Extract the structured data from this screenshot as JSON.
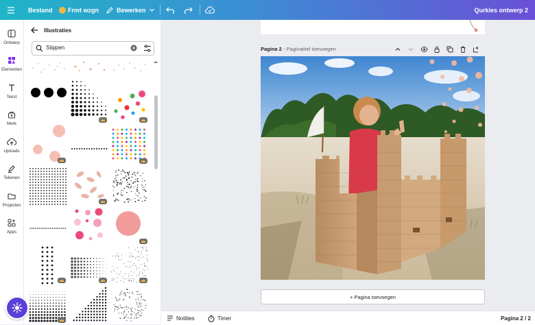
{
  "topbar": {
    "menu_icon": "hamburger-icon",
    "file_label": "Bestand",
    "resize_label": "Frmt wzgn",
    "edit_label": "Bewerken",
    "design_title": "Qurkies ontwerp 2"
  },
  "rail": {
    "items": [
      {
        "label": "Ontwerp",
        "icon": "layout-icon"
      },
      {
        "label": "Elementen",
        "icon": "elements-icon"
      },
      {
        "label": "Tekst",
        "icon": "text-icon"
      },
      {
        "label": "Merk",
        "icon": "brand-icon"
      },
      {
        "label": "Uploads",
        "icon": "cloud-upload-icon"
      },
      {
        "label": "Tekenen",
        "icon": "draw-icon"
      },
      {
        "label": "Projecten",
        "icon": "folder-icon"
      },
      {
        "label": "Apps",
        "icon": "apps-icon"
      }
    ],
    "active_index": 1
  },
  "panel": {
    "title": "Illustraties",
    "search_value": "Stippen",
    "tiles": [
      {
        "kind": "pastel-dots",
        "pro": false
      },
      {
        "kind": "peach-confetti",
        "pro": false
      },
      {
        "kind": "grey-scatter",
        "pro": false
      },
      {
        "kind": "three-black-circles",
        "pro": false
      },
      {
        "kind": "halftone-corner",
        "pro": true
      },
      {
        "kind": "colorful-confetti",
        "pro": true
      },
      {
        "kind": "pink-circles",
        "pro": true
      },
      {
        "kind": "dotted-line",
        "pro": false
      },
      {
        "kind": "rainbow-dot-grid",
        "pro": true
      },
      {
        "kind": "black-dot-grid",
        "pro": false
      },
      {
        "kind": "pink-petals",
        "pro": true
      },
      {
        "kind": "black-speckle",
        "pro": false
      },
      {
        "kind": "thin-dotted-line",
        "pro": false
      },
      {
        "kind": "pink-dot-cluster",
        "pro": false
      },
      {
        "kind": "big-pink-circle",
        "pro": true
      },
      {
        "kind": "black-dot-column",
        "pro": true
      },
      {
        "kind": "halftone-gradient",
        "pro": true
      },
      {
        "kind": "speckle-gradient",
        "pro": true
      },
      {
        "kind": "halftone-fade",
        "pro": true
      },
      {
        "kind": "dot-triangle",
        "pro": false
      },
      {
        "kind": "dot-circle",
        "pro": false
      }
    ]
  },
  "canvas": {
    "page_label": "Pagina 2",
    "page_title_placeholder": "Paginatitel toevoegen",
    "add_page_label": "+ Pagina toevoegen"
  },
  "bottombar": {
    "notes_label": "Notities",
    "timer_label": "Timer",
    "page_count": "Pagina 2 / 2"
  },
  "colors": {
    "topbar_start": "#1fb5c7",
    "topbar_end": "#6a4fd6",
    "fab": "#5b3fd8",
    "active_icon": "#7d2ae8"
  }
}
